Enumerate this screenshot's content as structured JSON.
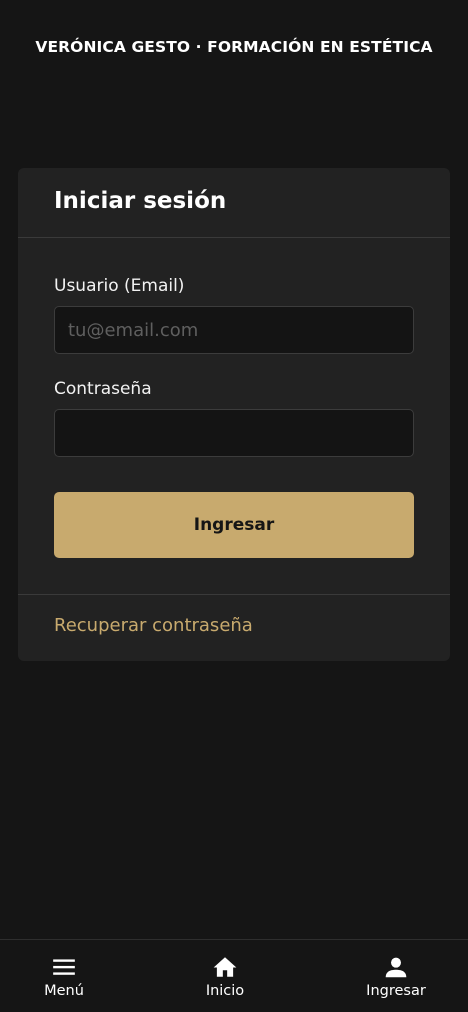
{
  "header": {
    "title": "VERÓNICA GESTO · FORMACIÓN EN ESTÉTICA"
  },
  "login_card": {
    "title": "Iniciar sesión",
    "email_label": "Usuario (Email)",
    "email_placeholder": "tu@email.com",
    "email_value": "",
    "password_label": "Contraseña",
    "password_value": "",
    "submit_label": "Ingresar",
    "recover_link": "Recuperar contraseña"
  },
  "bottom_nav": {
    "items": [
      {
        "label": "Menú",
        "icon": "menu-icon"
      },
      {
        "label": "Inicio",
        "icon": "home-icon"
      },
      {
        "label": "Ingresar",
        "icon": "user-icon"
      }
    ]
  },
  "colors": {
    "background": "#151515",
    "card": "#222222",
    "accent": "#c8aa6e",
    "input": "#141414"
  }
}
